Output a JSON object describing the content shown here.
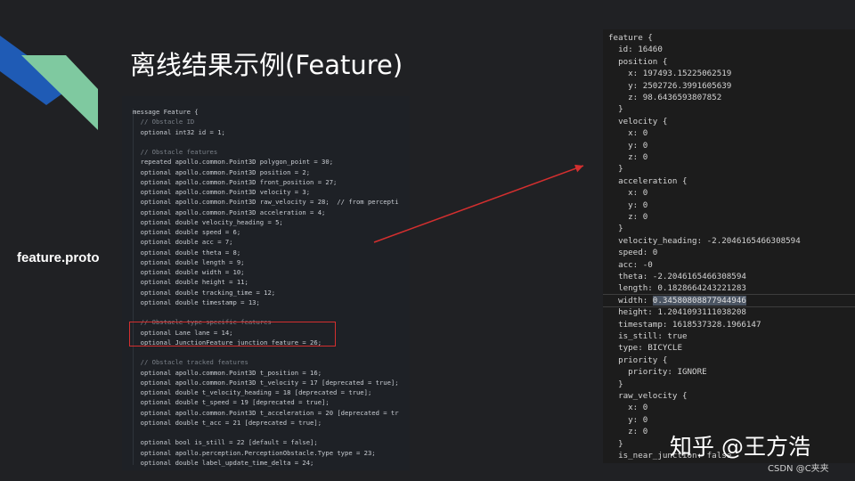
{
  "title": "离线结果示例(Feature)",
  "side_label": "feature.proto",
  "watermark": "知乎 @王方浩",
  "csdn_mark": "CSDN @C夹夹",
  "colors": {
    "background": "#202124",
    "accent_blue": "#1f5bb5",
    "accent_green": "#7fc9a0",
    "highlight_red": "#d32f2f",
    "arrow_red": "#d32f2f"
  },
  "code_lines": [
    "message Feature {",
    "  // Obstacle ID",
    "  optional int32 id = 1;",
    "",
    "  // Obstacle features",
    "  repeated apollo.common.Point3D polygon_point = 30;",
    "  optional apollo.common.Point3D position = 2;",
    "  optional apollo.common.Point3D front_position = 27;",
    "  optional apollo.common.Point3D velocity = 3;",
    "  optional apollo.common.Point3D raw_velocity = 28;  // from percepti",
    "  optional apollo.common.Point3D acceleration = 4;",
    "  optional double velocity_heading = 5;",
    "  optional double speed = 6;",
    "  optional double acc = 7;",
    "  optional double theta = 8;",
    "  optional double length = 9;",
    "  optional double width = 10;",
    "  optional double height = 11;",
    "  optional double tracking_time = 12;",
    "  optional double timestamp = 13;",
    "",
    "  // Obstacle type-specific features",
    "  optional Lane lane = 14;",
    "  optional JunctionFeature junction_feature = 26;",
    "",
    "  // Obstacle tracked features",
    "  optional apollo.common.Point3D t_position = 16;",
    "  optional apollo.common.Point3D t_velocity = 17 [deprecated = true];",
    "  optional double t_velocity_heading = 18 [deprecated = true];",
    "  optional double t_speed = 19 [deprecated = true];",
    "  optional apollo.common.Point3D t_acceleration = 20 [deprecated = tr",
    "  optional double t_acc = 21 [deprecated = true];",
    "",
    "  optional bool is_still = 22 [default = false];",
    "  optional apollo.perception.PerceptionObstacle.Type type = 23;",
    "  optional double label_update_time_delta = 24;"
  ],
  "feature_lines": [
    "feature {",
    "  id: 16460",
    "  position {",
    "    x: 197493.15225062519",
    "    y: 2502726.3991605639",
    "    z: 98.6436593807852",
    "  }",
    "  velocity {",
    "    x: 0",
    "    y: 0",
    "    z: 0",
    "  }",
    "  acceleration {",
    "    x: 0",
    "    y: 0",
    "    z: 0",
    "  }",
    "  velocity_heading: -2.2046165466308594",
    "  speed: 0",
    "  acc: -0",
    "  theta: -2.2046165466308594",
    "  length: 0.1828664243221283",
    "  width: 0.34580808877944946",
    "  height: 1.2041093111038208",
    "  timestamp: 1618537328.1966147",
    "  is_still: true",
    "  type: BICYCLE",
    "  priority {",
    "    priority: IGNORE",
    "  }",
    "  raw_velocity {",
    "    x: 0",
    "    y: 0",
    "    z: 0",
    "  }",
    "  is_near_junction: false"
  ],
  "selected_value": "0.34580808877944946"
}
